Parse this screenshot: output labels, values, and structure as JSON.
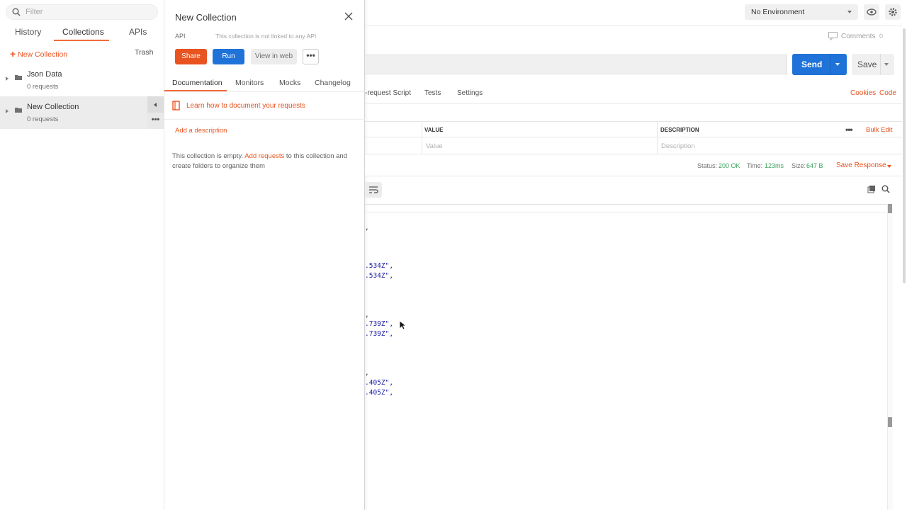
{
  "sidebar": {
    "filter_placeholder": "Filter",
    "tabs": [
      "History",
      "Collections",
      "APIs"
    ],
    "new_collection": "New Collection",
    "trash": "Trash",
    "collections": [
      {
        "name": "Json Data",
        "count": "0 requests"
      },
      {
        "name": "New Collection",
        "count": "0 requests"
      }
    ]
  },
  "panel": {
    "title": "New Collection",
    "api_label": "API",
    "api_note": "This collection is not linked to any API",
    "share": "Share",
    "run": "Run",
    "view_web": "View in web",
    "more": "•••",
    "tabs": [
      "Documentation",
      "Monitors",
      "Mocks",
      "Changelog"
    ],
    "learn": "Learn how to document your requests",
    "add_description": "Add a description",
    "empty_pre": "This collection is empty. ",
    "empty_link": "Add requests",
    "empty_post": " to this collection and create folders to organize them"
  },
  "main": {
    "environment": "No Environment",
    "comments": "Comments",
    "comments_count": "0",
    "send": "Send",
    "save": "Save",
    "tabs": [
      "-request Script",
      "Tests",
      "Settings"
    ],
    "cookies": "Cookies",
    "code": "Code",
    "table": {
      "col_value": "VALUE",
      "col_description": "DESCRIPTION",
      "ph_value": "Value",
      "ph_description": "Description",
      "bulk_edit": "Bulk Edit",
      "dots": "•••"
    },
    "status_label": "Status:",
    "status_value": "200 OK",
    "time_label": "Time:",
    "time_value": "123ms",
    "size_label": "Size:",
    "size_value": "647 B",
    "save_response": "Save Response",
    "code_lines": [
      {
        "text": ",",
        "kind": "p"
      },
      {
        "text": ".534Z\",",
        "kind": "s"
      },
      {
        "text": ".534Z\",",
        "kind": "s"
      },
      {
        "text": ",",
        "kind": "p"
      },
      {
        "text": ".739Z\",",
        "kind": "s"
      },
      {
        "text": ".739Z\",",
        "kind": "s"
      },
      {
        "text": ",",
        "kind": "p"
      },
      {
        "text": ".405Z\",",
        "kind": "s"
      },
      {
        "text": ".405Z\",",
        "kind": "s"
      }
    ]
  },
  "colors": {
    "accent": "#e8531f",
    "blue": "#1f73d8",
    "ok": "#3aa35b"
  }
}
